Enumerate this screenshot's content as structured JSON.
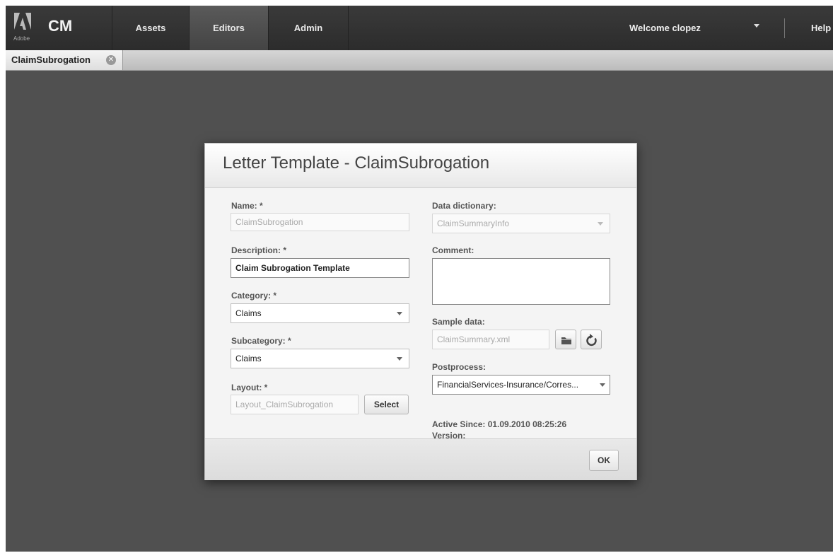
{
  "header": {
    "adobe_text": "Adobe",
    "app_name": "CM",
    "nav": [
      {
        "label": "Assets"
      },
      {
        "label": "Editors"
      },
      {
        "label": "Admin"
      }
    ],
    "active_nav": "Editors",
    "welcome": "Welcome clopez",
    "help": "Help"
  },
  "tabs": {
    "open": [
      {
        "label": "ClaimSubrogation"
      }
    ]
  },
  "dialog": {
    "title": "Letter Template - ClaimSubrogation",
    "left": {
      "name_label": "Name: *",
      "name_value": "ClaimSubrogation",
      "description_label": "Description: *",
      "description_value": "Claim Subrogation Template",
      "category_label": "Category: *",
      "category_value": "Claims",
      "subcategory_label": "Subcategory: *",
      "subcategory_value": "Claims",
      "layout_label": "Layout: *",
      "layout_value": "Layout_ClaimSubrogation",
      "select_button": "Select"
    },
    "right": {
      "data_dictionary_label": "Data dictionary:",
      "data_dictionary_value": "ClaimSummaryInfo",
      "comment_label": "Comment:",
      "comment_value": "",
      "sample_data_label": "Sample data:",
      "sample_data_value": "ClaimSummary.xml",
      "postprocess_label": "Postprocess:",
      "postprocess_value": "FinancialServices-Insurance/Corres...",
      "active_since": "Active Since: 01.09.2010 08:25:26",
      "version": "Version:"
    },
    "ok_button": "OK"
  }
}
